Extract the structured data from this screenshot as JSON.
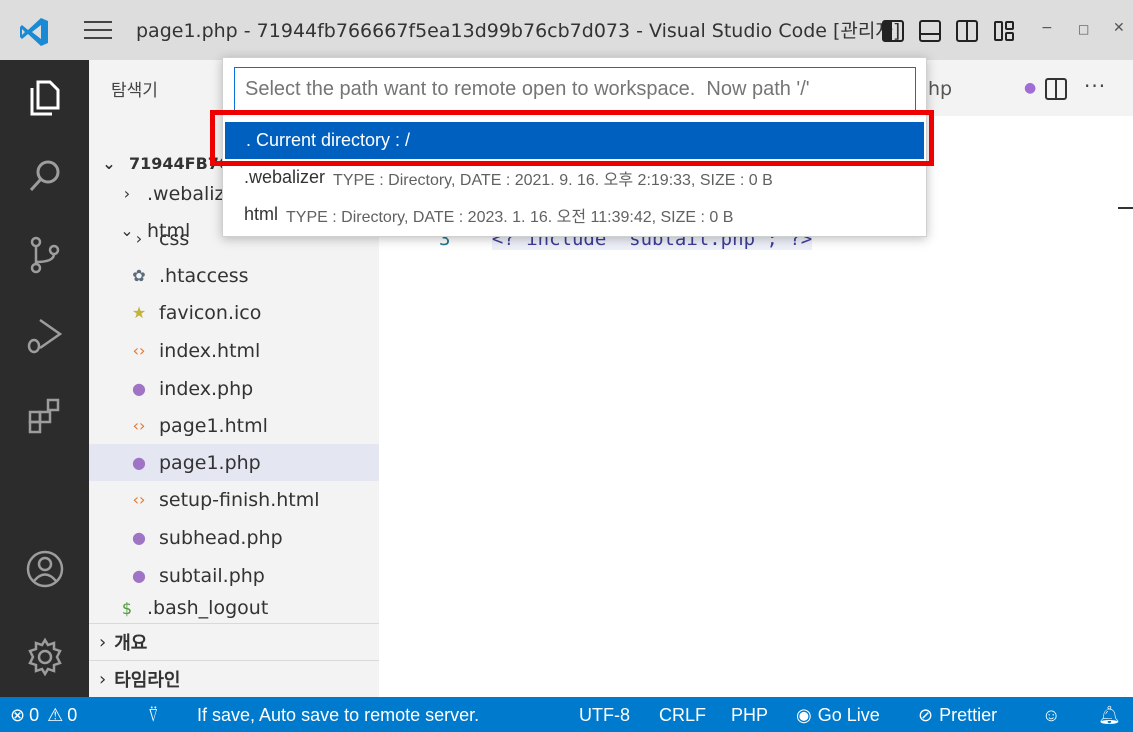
{
  "title_bar": {
    "title": "page1.php - 71944fb766667f5ea13d99b76cb7d073 - Visual Studio Code [관리자]",
    "window_controls": [
      "−",
      "□",
      "✕"
    ]
  },
  "activity_bar": {
    "icons": [
      "explorer-icon",
      "search-icon",
      "source-control-icon",
      "run-debug-icon",
      "extensions-icon",
      "account-icon",
      "settings-gear-icon"
    ]
  },
  "sidebar": {
    "header": "탐색기",
    "root_label": "71944FB76",
    "items": [
      {
        "label": ".webalizer",
        "icon": "chevron-right",
        "indent": 1
      },
      {
        "label": "html",
        "icon": "chevron-down",
        "indent": 1
      },
      {
        "label": "css",
        "icon": "chevron-right",
        "indent": 2
      },
      {
        "label": ".htaccess",
        "icon": "gear",
        "indent": 2
      },
      {
        "label": "favicon.ico",
        "icon": "star",
        "indent": 2
      },
      {
        "label": "index.html",
        "icon": "html",
        "indent": 2
      },
      {
        "label": "index.php",
        "icon": "php",
        "indent": 2
      },
      {
        "label": "page1.html",
        "icon": "html",
        "indent": 2
      },
      {
        "label": "page1.php",
        "icon": "php",
        "indent": 2
      },
      {
        "label": "setup-finish.html",
        "icon": "html",
        "indent": 2
      },
      {
        "label": "subhead.php",
        "icon": "php",
        "indent": 2
      },
      {
        "label": "subtail.php",
        "icon": "php",
        "indent": 2
      },
      {
        "label": ".bash_logout",
        "icon": "dollar",
        "indent": 1
      }
    ],
    "selected_item": "page1.php",
    "sections": [
      "개요",
      "타임라인"
    ]
  },
  "editor": {
    "partial_tab_text": "hp",
    "code_line_number": "3",
    "code_text": "<? include \"subtail.php\"; ?>"
  },
  "quick_pick": {
    "placeholder": "Select the path want to remote open to workspace.  Now path '/'",
    "items": [
      {
        "label": ". Current directory : /",
        "description": ""
      },
      {
        "label": ".webalizer",
        "description": "TYPE : Directory, DATE : 2021. 9. 16. 오후 2:19:33, SIZE : 0 B"
      },
      {
        "label": "html",
        "description": "TYPE : Directory, DATE : 2023. 1. 16. 오전 11:39:42, SIZE : 0 B"
      }
    ]
  },
  "status_bar": {
    "errors": "0",
    "warnings": "0",
    "message": "If save, Auto save to remote server.",
    "encoding": "UTF-8",
    "eol": "CRLF",
    "language": "PHP",
    "go_live": "Go Live",
    "prettier": "Prettier"
  },
  "colors": {
    "accent_blue": "#007acc",
    "selection_blue": "#0060c0",
    "highlight_red": "#ee0000",
    "activity_bar_bg": "#2c2c2c"
  }
}
